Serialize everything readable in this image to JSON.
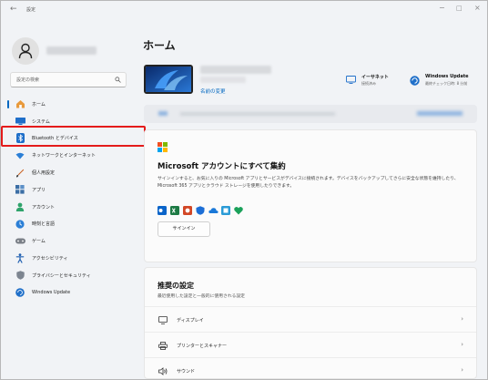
{
  "window": {
    "app_title": "設定",
    "back_glyph": "←",
    "minimize_glyph": "−",
    "maximize_glyph": "□",
    "close_glyph": "×"
  },
  "sidebar": {
    "search_placeholder": "設定の検索",
    "nav_items": [
      {
        "label": "ホーム",
        "icon": "home-icon"
      },
      {
        "label": "システム",
        "icon": "system-icon"
      },
      {
        "label": "Bluetooth とデバイス",
        "icon": "bluetooth-icon"
      },
      {
        "label": "ネットワークとインターネット",
        "icon": "network-icon"
      },
      {
        "label": "個人用設定",
        "icon": "personalization-icon"
      },
      {
        "label": "アプリ",
        "icon": "apps-icon"
      },
      {
        "label": "アカウント",
        "icon": "accounts-icon"
      },
      {
        "label": "時刻と言語",
        "icon": "time-language-icon"
      },
      {
        "label": "ゲーム",
        "icon": "gaming-icon"
      },
      {
        "label": "アクセシビリティ",
        "icon": "accessibility-icon"
      },
      {
        "label": "プライバシーとセキュリティ",
        "icon": "privacy-icon"
      },
      {
        "label": "Windows Update",
        "icon": "windows-update-icon"
      }
    ]
  },
  "main": {
    "page_title": "ホーム",
    "rename_link": "名前の変更",
    "status": {
      "ethernet": {
        "title": "イーサネット",
        "subtitle": "接続済み"
      },
      "update": {
        "title": "Windows Update",
        "subtitle": "最終チェック日時: 8 分前"
      }
    },
    "ms_card": {
      "title": "Microsoft アカウントにすべて集約",
      "description": "サインインすると、お気に入りの Microsoft アプリとサービスがデバイスに接続されます。デバイスをバックアップしてさらに安全な状態を維持したり、Microsoft 365 アプリとクラウド ストレージを使用したりできます。",
      "button_label": "サインイン"
    },
    "recommended": {
      "title": "推奨の設定",
      "subtitle": "最近使用した設定と一般的に使用される設定",
      "items": [
        {
          "label": "ディスプレイ",
          "icon": "display-icon"
        },
        {
          "label": "プリンターとスキャナー",
          "icon": "printer-icon"
        },
        {
          "label": "サウンド",
          "icon": "sound-icon"
        }
      ],
      "chevron": "›"
    }
  },
  "colors": {
    "accent": "#0067c0",
    "highlight_box": "#e41b1b"
  }
}
